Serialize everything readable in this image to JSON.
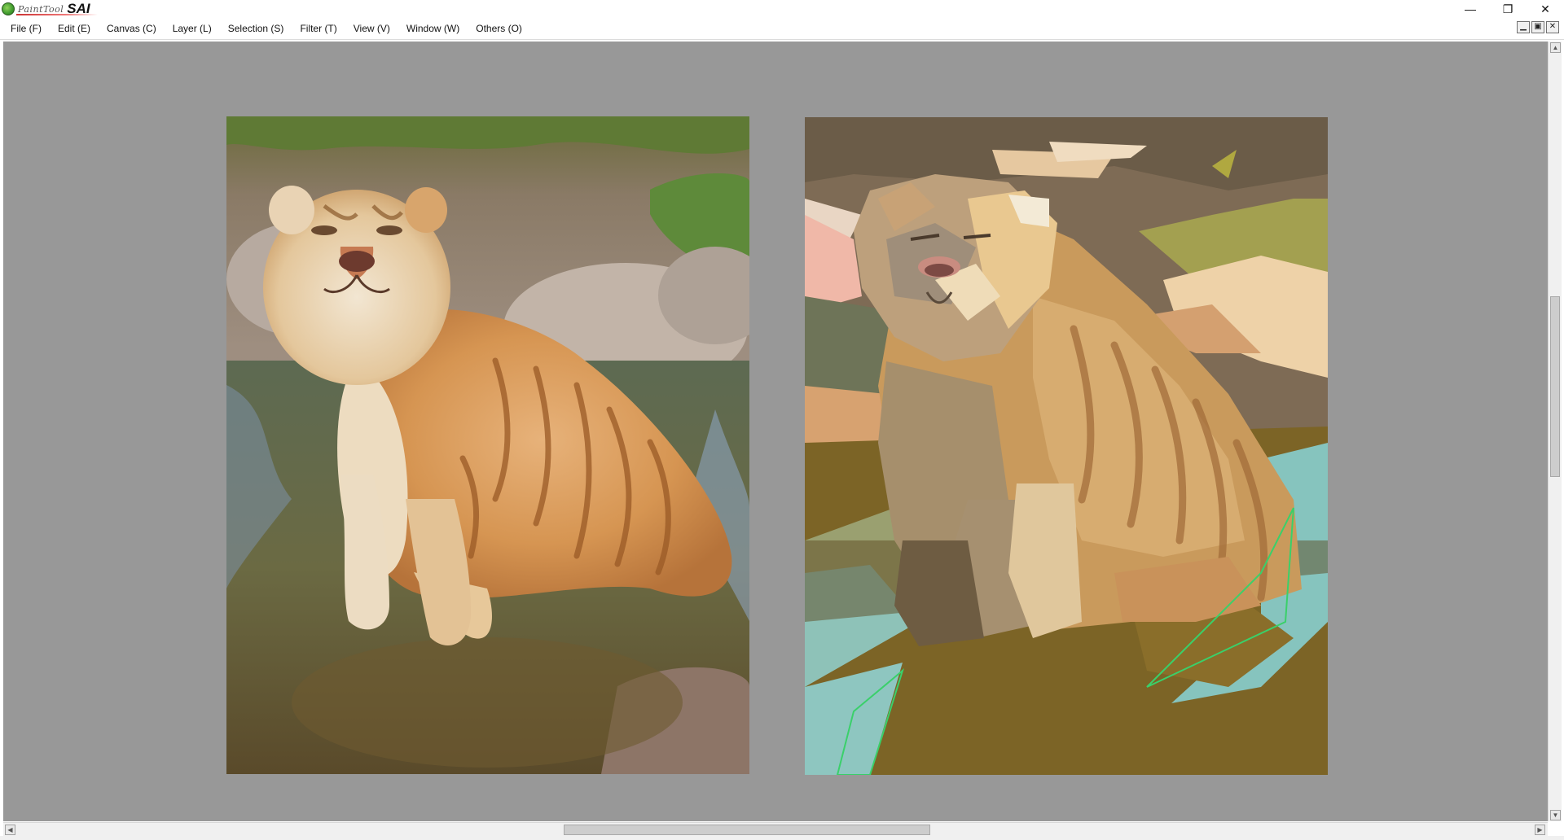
{
  "window": {
    "app_name_small": "PaintTool",
    "app_name_big": "SAI",
    "minimize_glyph": "—",
    "restore_glyph": "❐",
    "close_glyph": "✕"
  },
  "menu": {
    "items": [
      {
        "label": "File (F)"
      },
      {
        "label": "Edit (E)"
      },
      {
        "label": "Canvas (C)"
      },
      {
        "label": "Layer (L)"
      },
      {
        "label": "Selection (S)"
      },
      {
        "label": "Filter (T)"
      },
      {
        "label": "View (V)"
      },
      {
        "label": "Window (W)"
      },
      {
        "label": "Others (O)"
      }
    ]
  },
  "mdi": {
    "minimize_glyph": "▁",
    "restore_glyph": "▣",
    "close_glyph": "✕"
  },
  "scrollbars": {
    "up_arrow": "▲",
    "down_arrow": "▼",
    "left_arrow": "◀",
    "right_arrow": "▶"
  },
  "colors": {
    "workspace_bg": "#989898",
    "titlebar_bg": "#ffffff",
    "scrollbar_track": "#f0f0f0"
  },
  "canvases": [
    {
      "name": "reference-photo",
      "subject": "golden tiger sitting in water"
    },
    {
      "name": "paint-study",
      "subject": "flat-color painted tiger study"
    }
  ]
}
